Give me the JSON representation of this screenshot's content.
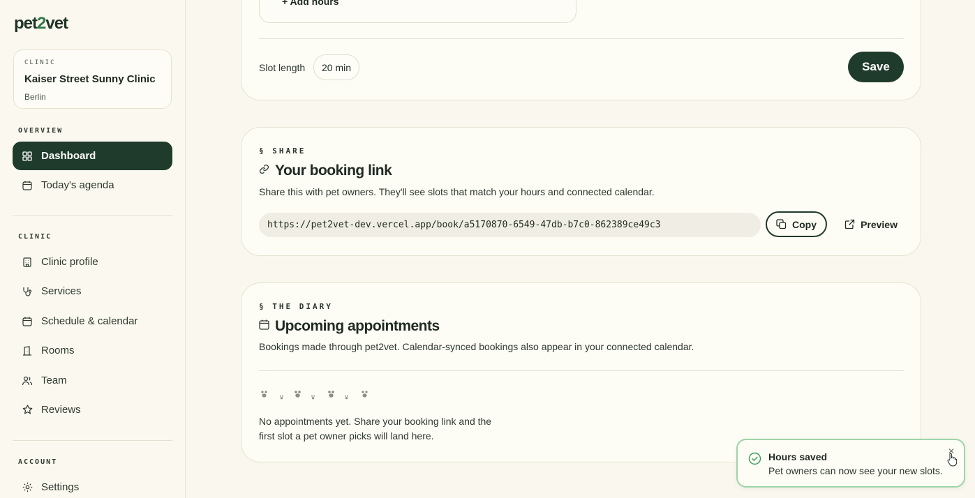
{
  "brand": {
    "logo_pre": "pet",
    "logo_two": "2",
    "logo_post": "vet"
  },
  "clinic_card": {
    "tag": "CLINIC",
    "name": "Kaiser Street Sunny Clinic",
    "city": "Berlin"
  },
  "sidebar": {
    "overview_label": "OVERVIEW",
    "clinic_label": "CLINIC",
    "account_label": "ACCOUNT",
    "items": [
      {
        "label": "Dashboard",
        "icon": "dashboard-icon",
        "active": true
      },
      {
        "label": "Today's agenda",
        "icon": "calendar-icon"
      },
      {
        "label": "Clinic profile",
        "icon": "building-icon"
      },
      {
        "label": "Services",
        "icon": "stethoscope-icon"
      },
      {
        "label": "Schedule & calendar",
        "icon": "calendar-icon"
      },
      {
        "label": "Rooms",
        "icon": "door-icon"
      },
      {
        "label": "Team",
        "icon": "users-icon"
      },
      {
        "label": "Reviews",
        "icon": "star-icon"
      },
      {
        "label": "Settings",
        "icon": "gear-icon"
      }
    ]
  },
  "hours_card": {
    "add_hours": "+ Add hours",
    "slot_label": "Slot length",
    "slot_value": "20 min",
    "save_label": "Save"
  },
  "share_card": {
    "eyebrow": "§ SHARE",
    "title": "Your booking link",
    "description": "Share this with pet owners. They'll see slots that match your hours and connected calendar.",
    "url": "https://pet2vet-dev.vercel.app/book/a5170870-6549-47db-b7c0-862389ce49c3",
    "copy_label": "Copy",
    "preview_label": "Preview"
  },
  "diary_card": {
    "eyebrow": "§ THE DIARY",
    "title": "Upcoming appointments",
    "description": "Bookings made through pet2vet. Calendar-synced bookings also appear in your connected calendar.",
    "empty_text": "No appointments yet. Share your booking link and the first slot a pet owner picks will land here."
  },
  "toast": {
    "title": "Hours saved",
    "message": "Pet owners can now see your new slots.",
    "accent": "#9fd4a9"
  },
  "colors": {
    "primary": "#1f3b2c",
    "background": "#faf8ee"
  }
}
